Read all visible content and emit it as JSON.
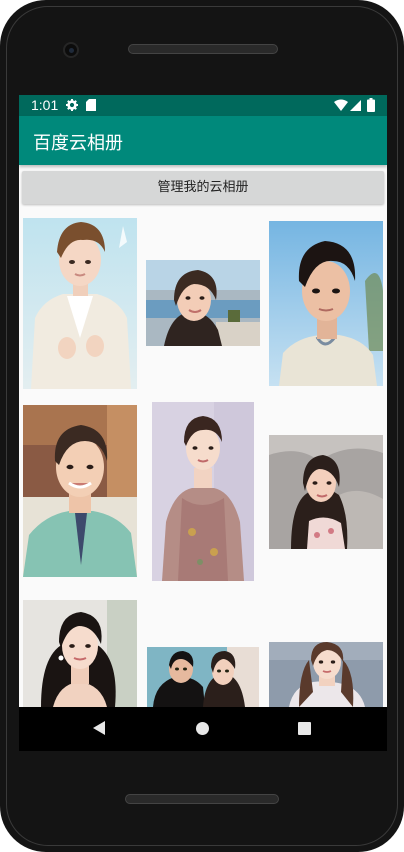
{
  "status_bar": {
    "time": "1:01"
  },
  "app_bar": {
    "title": "百度云相册"
  },
  "manage_button": {
    "label": "管理我的云相册"
  },
  "photos": [
    {
      "name": "photo-young-man-white-suit"
    },
    {
      "name": "photo-woman-beach-selfie"
    },
    {
      "name": "photo-man-blue-sky"
    },
    {
      "name": "photo-man-green-shirt"
    },
    {
      "name": "photo-woman-floral-dress"
    },
    {
      "name": "photo-woman-rock-background"
    },
    {
      "name": "photo-woman-black-dress"
    },
    {
      "name": "photo-couple-selfie"
    },
    {
      "name": "photo-woman-white-dress"
    }
  ],
  "nav_bar": {
    "back": "back-icon",
    "home": "home-icon",
    "recents": "recents-icon"
  }
}
